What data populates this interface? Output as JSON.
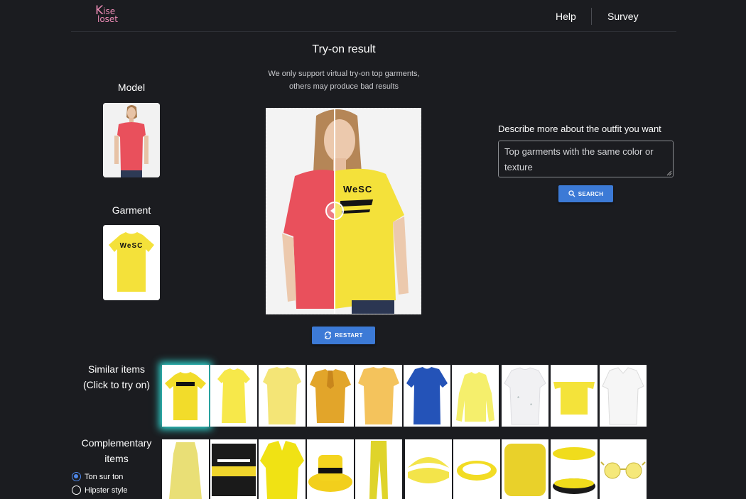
{
  "header": {
    "logo_line1": "ise",
    "logo_line2": "loset",
    "logo_k": "K",
    "nav": {
      "help": "Help",
      "survey": "Survey"
    }
  },
  "left": {
    "model_title": "Model",
    "garment_title": "Garment",
    "garment_print": "WeSC"
  },
  "center": {
    "title": "Try-on result",
    "subtitle_line1": "We only support virtual try-on top garments,",
    "subtitle_line2": "others may produce bad results",
    "restart_label": "RESTART",
    "shirt_print": "WeSC"
  },
  "right": {
    "describe_label": "Describe more about the outfit you want",
    "describe_value": "Top garments with the same color or texture",
    "search_label": "SEARCH"
  },
  "similar": {
    "label_line1": "Similar items",
    "label_line2": "(Click to try on)"
  },
  "complementary": {
    "label_line1": "Complementary",
    "label_line2": "items",
    "options": [
      "Ton sur ton",
      "Hipster style"
    ],
    "selected": "Ton sur ton"
  },
  "colors": {
    "background": "#1b1c20",
    "accent_button": "#3c7ad6",
    "logo_pink": "#e98ab3",
    "selection_glow": "#2fd6d0",
    "garment_yellow": "#f4e13a",
    "model_red": "#e9505c"
  }
}
